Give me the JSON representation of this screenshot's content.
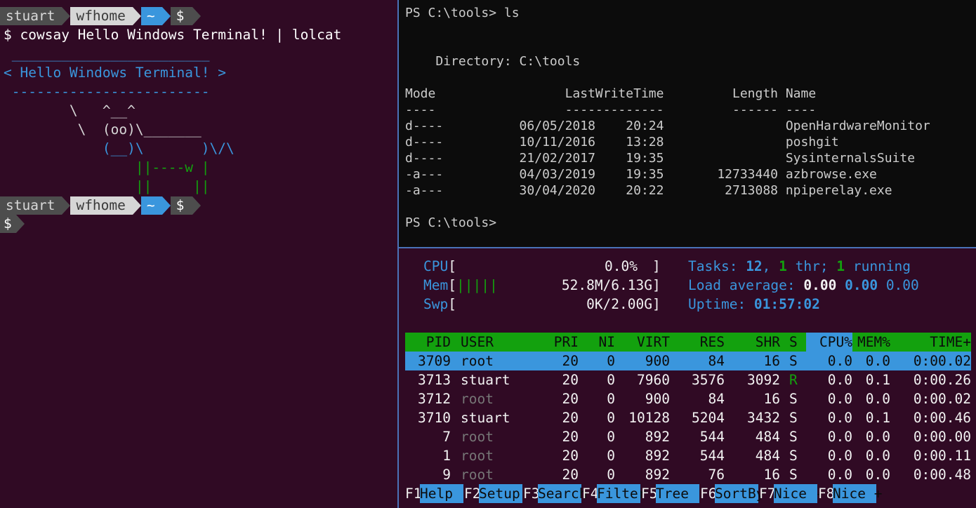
{
  "left": {
    "prompt": {
      "user": "stuart",
      "host": "wfhome",
      "dir": "~",
      "symbol": "$"
    },
    "command_prefix": "$",
    "command": " cowsay Hello Windows Terminal! | lolcat",
    "cow_lines": [
      " ________________________",
      "< Hello Windows Terminal! >",
      " ------------------------",
      "        \\   ^__^",
      "         \\  (oo)\\_______",
      "            (__)\\       )\\/\\",
      "                ||----w |",
      "                ||     ||"
    ],
    "cursor_prompt": "$"
  },
  "top_right": {
    "lines": [
      "PS C:\\tools> ls",
      "",
      "",
      "    Directory: C:\\tools",
      "",
      "Mode                 LastWriteTime         Length Name",
      "----                 -------------         ------ ----",
      "d----          06/05/2018    20:24                OpenHardwareMonitor",
      "d----          10/11/2016    13:28                poshgit",
      "d----          21/02/2017    19:35                SysinternalsSuite",
      "-a---          04/03/2019    19:35       12733440 azbrowse.exe",
      "-a---          30/04/2020    20:22        2713088 npiperelay.exe",
      "",
      "PS C:\\tools>"
    ]
  },
  "htop": {
    "cpu": {
      "label": "CPU",
      "open": "[",
      "bars": "",
      "value": "0.0%",
      "close": "]"
    },
    "mem": {
      "label": "Mem",
      "open": "[",
      "bars": "|||||",
      "value": "52.8M/6.13G",
      "close": "]"
    },
    "swp": {
      "label": "Swp",
      "open": "[",
      "bars": "",
      "value": "0K/2.00G",
      "close": "]"
    },
    "tasks": {
      "label": "Tasks: ",
      "count": "12",
      "sep1": ", ",
      "thr": "1",
      "thr_label": " thr; ",
      "running": "1",
      "running_label": " running"
    },
    "load": {
      "label": "Load average: ",
      "l1": "0.00",
      "l5": "0.00",
      "l15": "0.00"
    },
    "uptime": {
      "label": "Uptime: ",
      "value": "01:57:02"
    },
    "columns": [
      "PID",
      "USER",
      "PRI",
      "NI",
      "VIRT",
      "RES",
      "SHR",
      "S",
      "CPU%",
      "MEM%",
      "TIME+"
    ],
    "rows": [
      {
        "pid": "3709",
        "user": "root",
        "pri": "20",
        "ni": "0",
        "virt": "900",
        "res": "84",
        "shr": "16",
        "s": "S",
        "cpu": "0.0",
        "mem": "0.0",
        "time": "0:00.02"
      },
      {
        "pid": "3713",
        "user": "stuart",
        "pri": "20",
        "ni": "0",
        "virt": "7960",
        "res": "3576",
        "shr": "3092",
        "s": "R",
        "cpu": "0.0",
        "mem": "0.1",
        "time": "0:00.26"
      },
      {
        "pid": "3712",
        "user": "root",
        "pri": "20",
        "ni": "0",
        "virt": "900",
        "res": "84",
        "shr": "16",
        "s": "S",
        "cpu": "0.0",
        "mem": "0.0",
        "time": "0:00.02"
      },
      {
        "pid": "3710",
        "user": "stuart",
        "pri": "20",
        "ni": "0",
        "virt": "10128",
        "res": "5204",
        "shr": "3432",
        "s": "S",
        "cpu": "0.0",
        "mem": "0.1",
        "time": "0:00.46"
      },
      {
        "pid": "7",
        "user": "root",
        "pri": "20",
        "ni": "0",
        "virt": "892",
        "res": "544",
        "shr": "484",
        "s": "S",
        "cpu": "0.0",
        "mem": "0.0",
        "time": "0:00.00"
      },
      {
        "pid": "1",
        "user": "root",
        "pri": "20",
        "ni": "0",
        "virt": "892",
        "res": "544",
        "shr": "484",
        "s": "S",
        "cpu": "0.0",
        "mem": "0.0",
        "time": "0:00.11"
      },
      {
        "pid": "9",
        "user": "root",
        "pri": "20",
        "ni": "0",
        "virt": "892",
        "res": "76",
        "shr": "16",
        "s": "S",
        "cpu": "0.0",
        "mem": "0.0",
        "time": "0:00.48"
      }
    ],
    "fkeys": [
      {
        "key": "F1",
        "label": "Help  "
      },
      {
        "key": "F2",
        "label": "Setup "
      },
      {
        "key": "F3",
        "label": "Search"
      },
      {
        "key": "F4",
        "label": "Filter"
      },
      {
        "key": "F5",
        "label": "Tree  "
      },
      {
        "key": "F6",
        "label": "SortBy"
      },
      {
        "key": "F7",
        "label": "Nice -"
      },
      {
        "key": "F8",
        "label": "Nice +"
      }
    ]
  },
  "colors": {
    "left_bg": "#300a24",
    "ps_bg": "#0c0c0c",
    "accent_blue": "#3a96dd",
    "green": "#13a10e"
  }
}
